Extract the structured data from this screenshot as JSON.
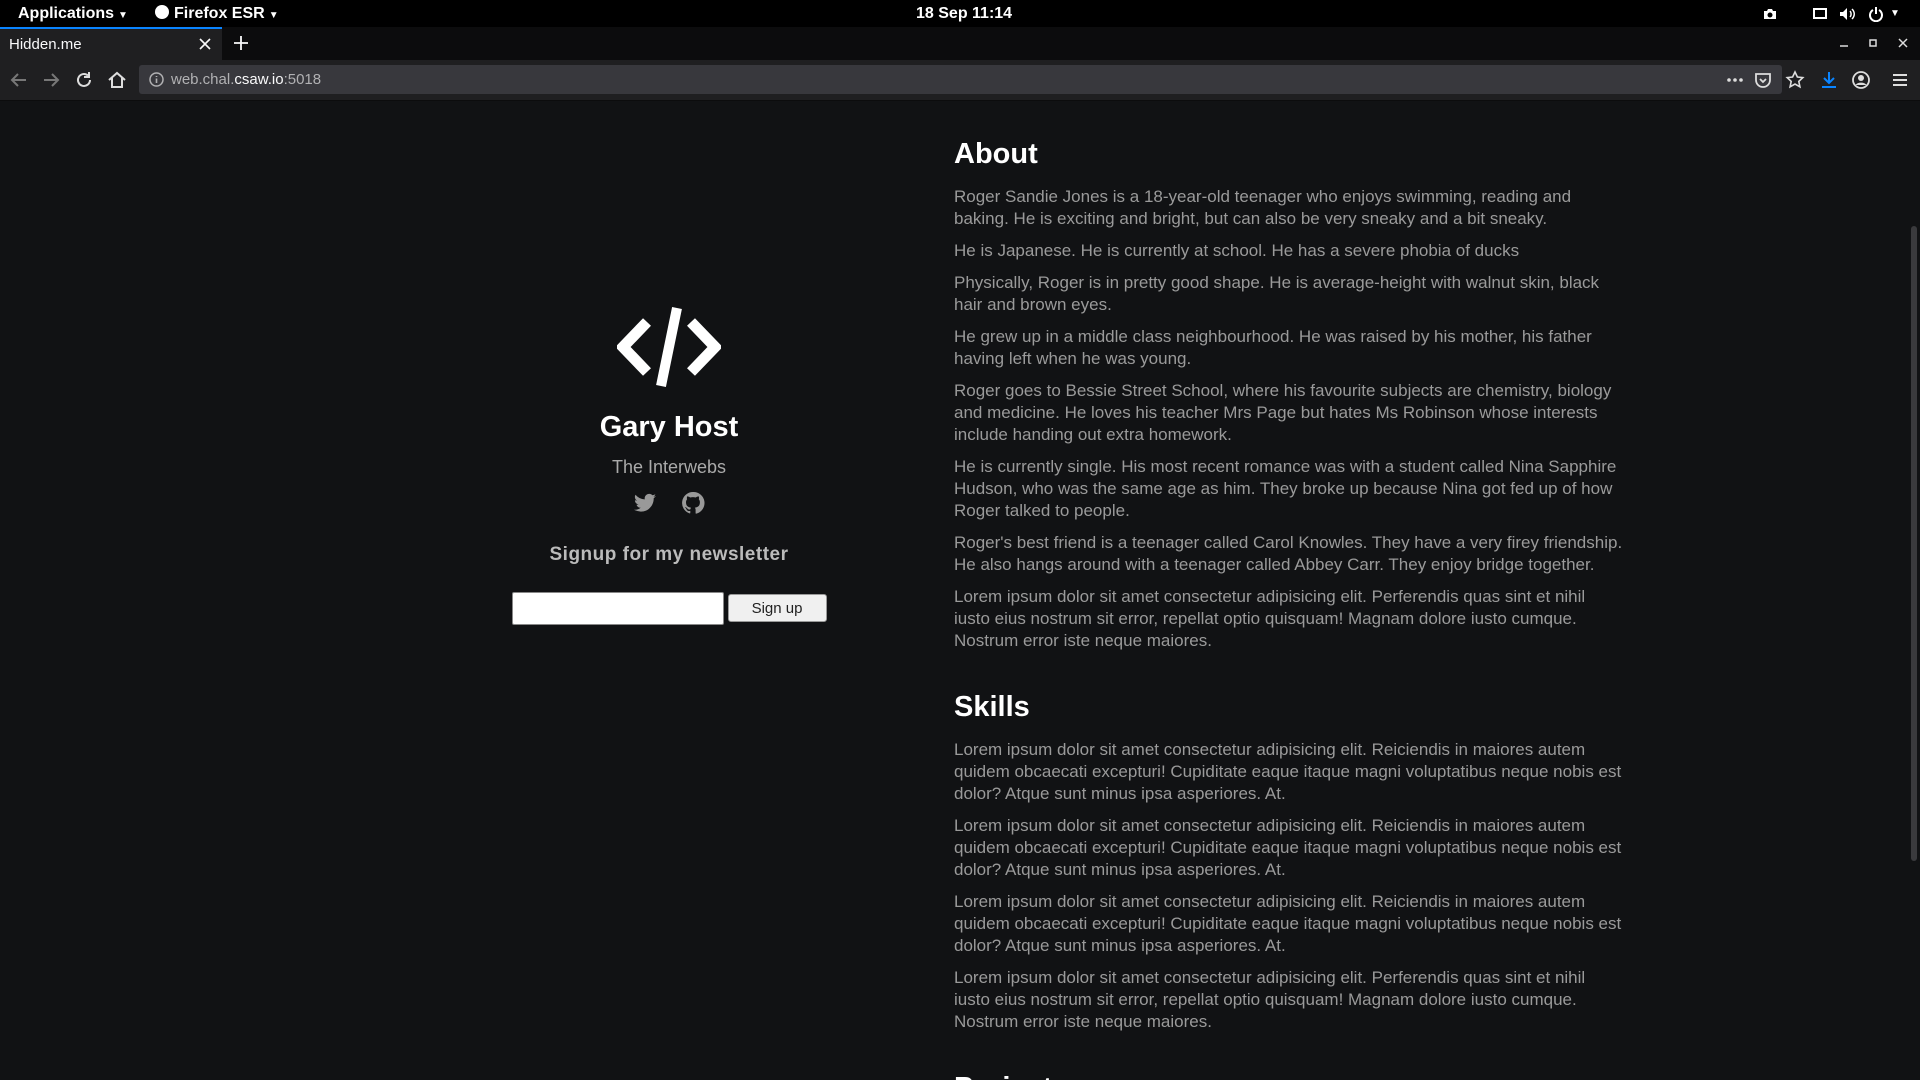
{
  "topbar": {
    "applications": "Applications",
    "firefox": "Firefox ESR",
    "clock": "18 Sep  11:14"
  },
  "tab": {
    "title": "Hidden.me"
  },
  "url": {
    "prefix": "web.chal.",
    "host": "csaw.io",
    "suffix": ":5018"
  },
  "profile": {
    "name": "Gary Host",
    "location": "The Interwebs",
    "newsletter_heading": "Signup for my newsletter",
    "email_value": "",
    "signup_label": "Sign up"
  },
  "about": {
    "heading": "About",
    "paragraphs": [
      "Roger Sandie Jones is a 18-year-old teenager who enjoys swimming, reading and baking. He is exciting and bright, but can also be very sneaky and a bit sneaky.",
      "He is Japanese. He is currently at school. He has a severe phobia of ducks",
      "Physically, Roger is in pretty good shape. He is average-height with walnut skin, black hair and brown eyes.",
      "He grew up in a middle class neighbourhood. He was raised by his mother, his father having left when he was young.",
      "Roger goes to Bessie Street School, where his favourite subjects are chemistry, biology and medicine. He loves his teacher Mrs Page but hates Ms Robinson whose interests include handing out extra homework.",
      "He is currently single. His most recent romance was with a student called Nina Sapphire Hudson, who was the same age as him. They broke up because Nina got fed up of how Roger talked to people.",
      "Roger's best friend is a teenager called Carol Knowles. They have a very firey friendship. He also hangs around with a teenager called Abbey Carr. They enjoy bridge together.",
      "Lorem ipsum dolor sit amet consectetur adipisicing elit. Perferendis quas sint et nihil iusto eius nostrum sit error, repellat optio quisquam! Magnam dolore iusto cumque. Nostrum error iste neque maiores."
    ]
  },
  "skills": {
    "heading": "Skills",
    "paragraphs": [
      "Lorem ipsum dolor sit amet consectetur adipisicing elit. Reiciendis in maiores autem quidem obcaecati excepturi! Cupiditate eaque itaque magni voluptatibus neque nobis est dolor? Atque sunt minus ipsa asperiores. At.",
      "Lorem ipsum dolor sit amet consectetur adipisicing elit. Reiciendis in maiores autem quidem obcaecati excepturi! Cupiditate eaque itaque magni voluptatibus neque nobis est dolor? Atque sunt minus ipsa asperiores. At.",
      "Lorem ipsum dolor sit amet consectetur adipisicing elit. Reiciendis in maiores autem quidem obcaecati excepturi! Cupiditate eaque itaque magni voluptatibus neque nobis est dolor? Atque sunt minus ipsa asperiores. At.",
      "Lorem ipsum dolor sit amet consectetur adipisicing elit. Perferendis quas sint et nihil iusto eius nostrum sit error, repellat optio quisquam! Magnam dolore iusto cumque. Nostrum error iste neque maiores."
    ]
  },
  "projects": {
    "heading": "Projects"
  },
  "colors": {
    "accent": "#0a84ff",
    "page_bg": "#111214",
    "body_text": "#9a9a9a"
  },
  "icons": [
    "applications-caret-icon",
    "firefox-icon",
    "screenshot-icon",
    "display-icon",
    "volume-icon",
    "power-icon",
    "logo-code-icon",
    "twitter-icon",
    "github-icon"
  ]
}
